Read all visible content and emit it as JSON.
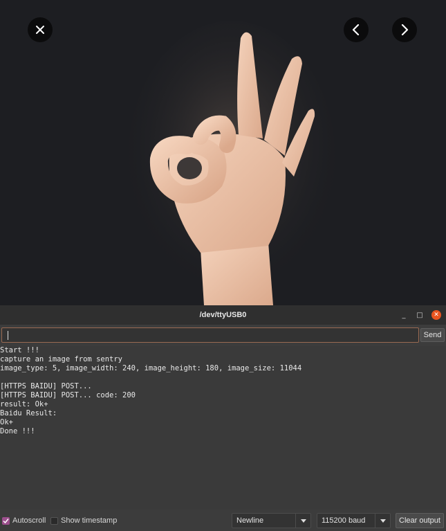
{
  "viewer": {
    "close_icon": "close-icon",
    "prev_icon": "chevron-left-icon",
    "next_icon": "chevron-right-icon",
    "photo": "hand-ok-gesture-photo"
  },
  "window": {
    "title": "/dev/ttyUSB0",
    "minimize_glyph": "_",
    "maximize_glyph": "□",
    "close_glyph": "✕"
  },
  "input": {
    "value": "",
    "send_label": "Send"
  },
  "output": {
    "lines": [
      "Start !!!",
      "capture an image from sentry",
      "image_type: 5, image_width: 240, image_height: 180, image_size: 11044",
      "",
      "[HTTPS BAIDU] POST...",
      "[HTTPS BAIDU] POST... code: 200",
      "result: Ok+",
      "Baidu Result:",
      "Ok+",
      "Done !!!"
    ]
  },
  "status": {
    "autoscroll_label": "Autoscroll",
    "autoscroll_checked": true,
    "timestamp_label": "Show timestamp",
    "timestamp_checked": false,
    "line_ending": "Newline",
    "baud": "115200 baud",
    "clear_label": "Clear output"
  },
  "colors": {
    "accent_checkbox": "#9c4f8d",
    "close_window": "#e9541f",
    "input_border": "#9a6a52"
  }
}
